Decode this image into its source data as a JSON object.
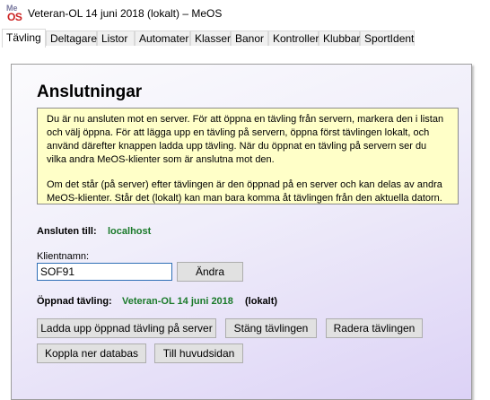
{
  "window": {
    "title": "Veteran-OL 14 juni 2018 (lokalt) – MeOS",
    "icon_top": "Me",
    "icon_bottom": "OS"
  },
  "tabs": [
    {
      "label": "Tävling",
      "active": true
    },
    {
      "label": "Deltagare"
    },
    {
      "label": "Listor"
    },
    {
      "label": "Automater"
    },
    {
      "label": "Klasser"
    },
    {
      "label": "Banor"
    },
    {
      "label": "Kontroller"
    },
    {
      "label": "Klubbar"
    },
    {
      "label": "SportIdent"
    }
  ],
  "main": {
    "heading": "Anslutningar",
    "info_paragraph_1": "Du är nu ansluten mot en server. För att öppna en tävling från servern, markera den i listan och välj öppna. För att lägga upp en tävling på servern, öppna först tävlingen lokalt, och använd därefter knappen ladda upp tävling. När du öppnat en tävling på servern ser du vilka andra MeOS-klienter som är anslutna mot den.",
    "info_paragraph_2": "Om det står (på server) efter tävlingen är den öppnad på en server och kan delas av andra MeOS-klienter. Står det (lokalt) kan man bara komma åt tävlingen från den aktuella datorn.",
    "connected_label": "Ansluten till:",
    "connected_value": "localhost",
    "client_name_label": "Klientnamn:",
    "client_name_value": "SOF91",
    "change_button": "Ändra",
    "opened_label": "Öppnad tävling:",
    "opened_value": "Veteran-OL 14 juni 2018",
    "opened_suffix": "(lokalt)",
    "buttons": {
      "upload": "Ladda upp öppnad tävling på server",
      "close": "Stäng tävlingen",
      "delete": "Radera tävlingen",
      "disconnect": "Koppla ner databas",
      "main_page": "Till huvudsidan"
    }
  },
  "colors": {
    "accent_green": "#1a7a2a",
    "info_bg": "#ffffc8",
    "panel_gradient_end": "#dcd2f6"
  }
}
